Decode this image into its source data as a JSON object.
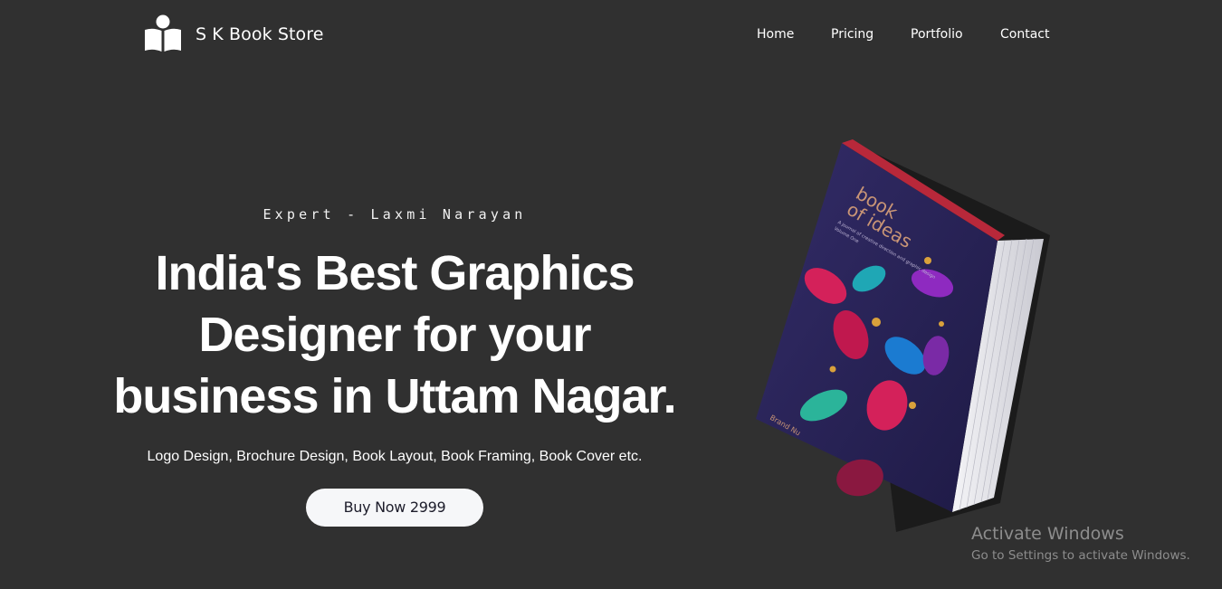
{
  "brand": {
    "name": "S K Book Store",
    "logo_icon": "reader-book-icon"
  },
  "nav": {
    "items": [
      {
        "label": "Home"
      },
      {
        "label": "Pricing"
      },
      {
        "label": "Portfolio"
      },
      {
        "label": "Contact"
      }
    ]
  },
  "hero": {
    "eyebrow": "Expert - Laxmi Narayan",
    "headline_lines": [
      "India's Best Graphics",
      "Designer for your",
      "business in Uttam Nagar."
    ],
    "subtitle": "Logo Design, Brochure Design, Book Layout, Book Framing, Book Cover etc.",
    "cta_label": "Buy Now 2999"
  },
  "book": {
    "cover_title_lines": [
      "book",
      "of ideas"
    ],
    "cover_caption": "A journal of creative direction and graphic design",
    "cover_volume": "Volume One",
    "cover_author": "Brand Nu",
    "colors": {
      "cover": "#2a2458",
      "pages": "#e9e9ee",
      "accent_pink": "#d4215a",
      "accent_teal": "#1fa7b5",
      "accent_gold": "#d9a13b"
    }
  },
  "watermark": {
    "title": "Activate Windows",
    "subtitle": "Go to Settings to activate Windows."
  },
  "colors": {
    "background": "#303030",
    "text": "#ffffff",
    "button_bg": "#f6f7f9",
    "button_text": "#1d1d2b"
  }
}
